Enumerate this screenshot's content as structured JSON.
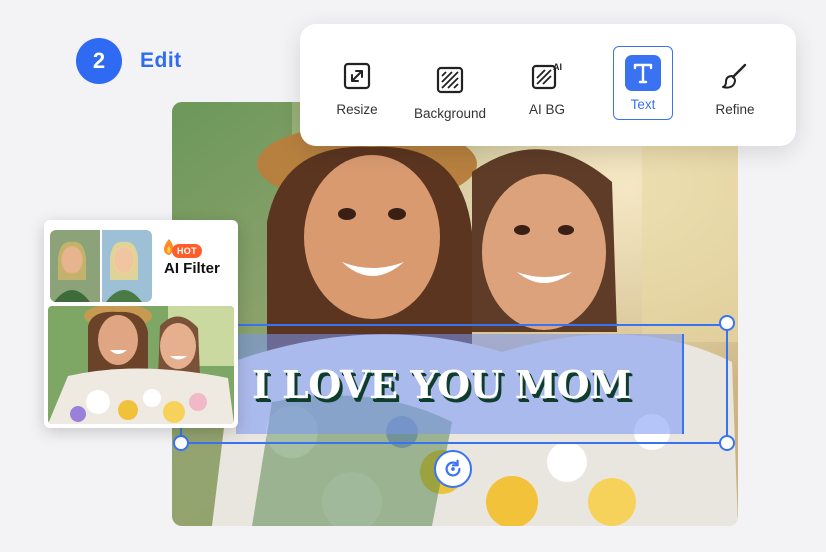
{
  "step": {
    "number": "2",
    "label": "Edit"
  },
  "toolbar": {
    "tools": [
      {
        "label": "Resize",
        "icon": "resize-icon"
      },
      {
        "label": "Background",
        "icon": "background-icon"
      },
      {
        "label": "AI BG",
        "icon": "ai-bg-icon",
        "badge": "AI"
      },
      {
        "label": "Text",
        "icon": "text-icon",
        "active": true
      },
      {
        "label": "Refine",
        "icon": "brush-icon"
      }
    ]
  },
  "side_card": {
    "badge": "HOT",
    "title": "AI Filter"
  },
  "canvas": {
    "overlay_text": "I LOVE YOU MOM"
  },
  "colors": {
    "accent": "#2f6bf2",
    "hot": "#ff5d2a",
    "text_shadow": "#0f3d2b"
  }
}
